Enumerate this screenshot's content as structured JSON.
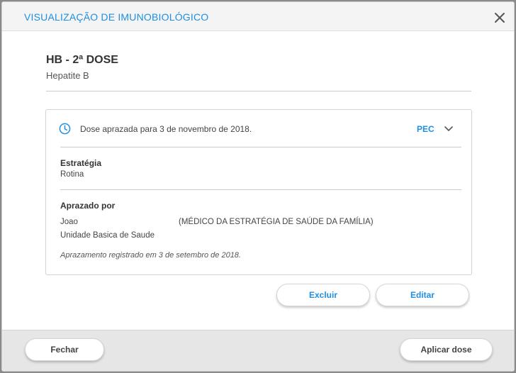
{
  "modal": {
    "title": "VISUALIZAÇÃO DE IMUNOBIOLÓGICO"
  },
  "vaccine": {
    "name": "HB - 2ª DOSE",
    "description": "Hepatite B"
  },
  "schedule": {
    "summary": "Dose aprazada para 3 de novembro de 2018.",
    "source": "PEC",
    "strategy_label": "Estratégia",
    "strategy_value": "Rotina",
    "scheduled_by_label": "Aprazado por",
    "professional_name": "Joao",
    "professional_role": "(MÉDICO DA ESTRATÉGIA DE SAÚDE DA FAMÍLIA)",
    "unit": "Unidade Basica de Saude",
    "registered_note": "Aprazamento registrado em 3 de setembro de 2018."
  },
  "actions": {
    "delete": "Excluir",
    "edit": "Editar",
    "close": "Fechar",
    "apply": "Aplicar dose"
  },
  "colors": {
    "accent": "#1e8fe1",
    "footer_bg": "#e6e6e6"
  },
  "icons": {
    "close": "close-icon",
    "clock": "clock-icon",
    "expand": "chevron-down-icon"
  }
}
